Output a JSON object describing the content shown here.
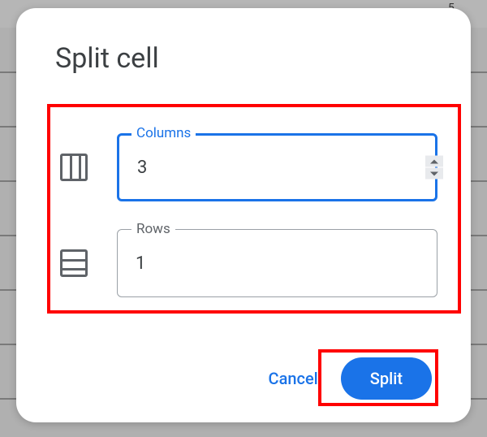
{
  "ruler": {
    "mark5": "5"
  },
  "dialog": {
    "title": "Split cell",
    "fields": {
      "columns": {
        "label": "Columns",
        "value": "3"
      },
      "rows": {
        "label": "Rows",
        "value": "1"
      }
    },
    "actions": {
      "cancel": "Cancel",
      "split": "Split"
    }
  }
}
